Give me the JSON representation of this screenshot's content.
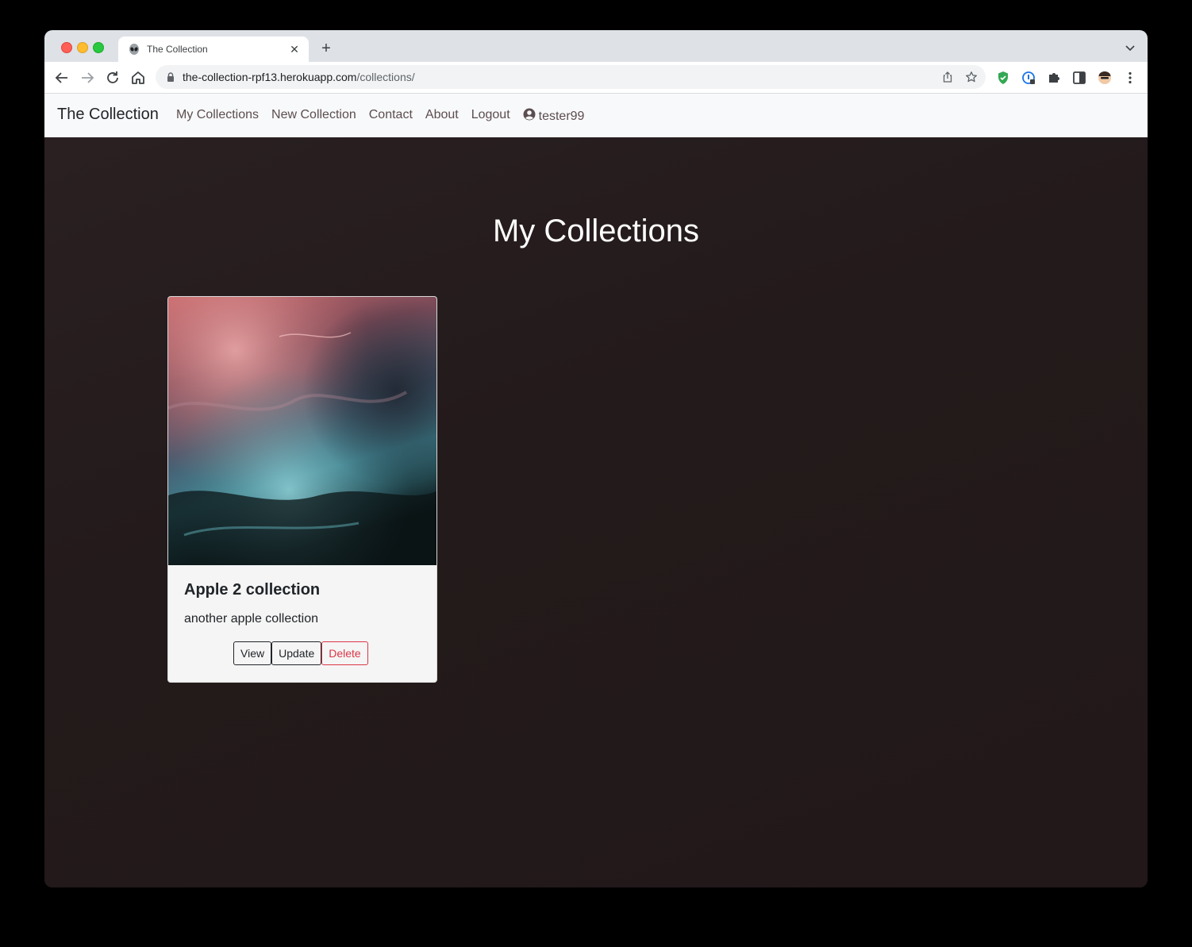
{
  "browser": {
    "tab_title": "The Collection",
    "tab_favicon": "alien-icon",
    "url_host": "the-collection-rpf13.herokuapp.com",
    "url_path": "/collections/"
  },
  "navbar": {
    "brand": "The Collection",
    "links": [
      "My Collections",
      "New Collection",
      "Contact",
      "About",
      "Logout"
    ],
    "username": "tester99",
    "user_icon": "user-circle-icon"
  },
  "page": {
    "title": "My Collections"
  },
  "collections": [
    {
      "title": "Apple 2 collection",
      "description": "another apple collection",
      "buttons": {
        "view": "View",
        "update": "Update",
        "delete": "Delete"
      }
    }
  ],
  "colors": {
    "background": "#231a1b",
    "navbar": "#f8f9fa",
    "delete": "#dc3545"
  }
}
